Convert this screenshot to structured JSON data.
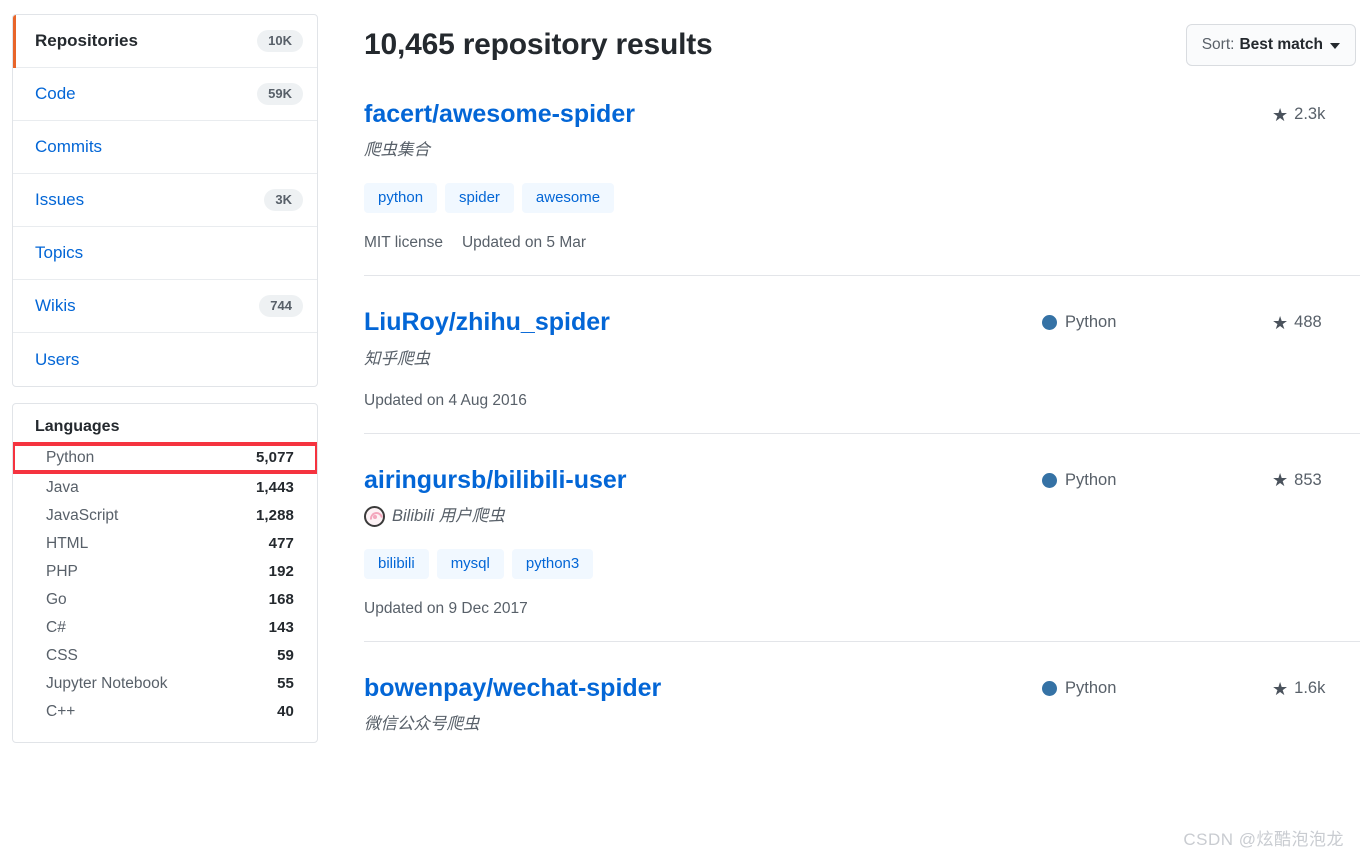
{
  "sidebar": {
    "nav_items": [
      {
        "label": "Repositories",
        "count": "10K",
        "active": true
      },
      {
        "label": "Code",
        "count": "59K",
        "active": false
      },
      {
        "label": "Commits",
        "count": "",
        "active": false
      },
      {
        "label": "Issues",
        "count": "3K",
        "active": false
      },
      {
        "label": "Topics",
        "count": "",
        "active": false
      },
      {
        "label": "Wikis",
        "count": "744",
        "active": false
      },
      {
        "label": "Users",
        "count": "",
        "active": false
      }
    ],
    "languages": {
      "title": "Languages",
      "items": [
        {
          "label": "Python",
          "count": "5,077",
          "highlighted": true
        },
        {
          "label": "Java",
          "count": "1,443",
          "highlighted": false
        },
        {
          "label": "JavaScript",
          "count": "1,288",
          "highlighted": false
        },
        {
          "label": "HTML",
          "count": "477",
          "highlighted": false
        },
        {
          "label": "PHP",
          "count": "192",
          "highlighted": false
        },
        {
          "label": "Go",
          "count": "168",
          "highlighted": false
        },
        {
          "label": "C#",
          "count": "143",
          "highlighted": false
        },
        {
          "label": "CSS",
          "count": "59",
          "highlighted": false
        },
        {
          "label": "Jupyter Notebook",
          "count": "55",
          "highlighted": false
        },
        {
          "label": "C++",
          "count": "40",
          "highlighted": false
        }
      ]
    }
  },
  "main": {
    "results_title": "10,465 repository results",
    "sort": {
      "label": "Sort:",
      "value": "Best match"
    },
    "results": [
      {
        "name": "facert/awesome-spider",
        "description": "爬虫集合",
        "emoji": "",
        "language": "",
        "language_color": "",
        "stars": "2.3k",
        "topics": [
          "python",
          "spider",
          "awesome"
        ],
        "license": "MIT license",
        "updated": "Updated on 5 Mar"
      },
      {
        "name": "LiuRoy/zhihu_spider",
        "description": "知乎爬虫",
        "emoji": "",
        "language": "Python",
        "language_color": "#3572A5",
        "stars": "488",
        "topics": [],
        "license": "",
        "updated": "Updated on 4 Aug 2016"
      },
      {
        "name": "airingursb/bilibili-user",
        "description": "Bilibili 用户爬虫",
        "emoji": "narutomaki-icon",
        "language": "Python",
        "language_color": "#3572A5",
        "stars": "853",
        "topics": [
          "bilibili",
          "mysql",
          "python3"
        ],
        "license": "",
        "updated": "Updated on 9 Dec 2017"
      },
      {
        "name": "bowenpay/wechat-spider",
        "description": "微信公众号爬虫",
        "emoji": "",
        "language": "Python",
        "language_color": "#3572A5",
        "stars": "1.6k",
        "topics": [],
        "license": "",
        "updated": ""
      }
    ]
  },
  "watermark": "CSDN @炫酷泡泡龙",
  "colors": {
    "accent_orange": "#e8652a",
    "link_blue": "#0366d6",
    "highlight_red": "#f5333f",
    "python_dot": "#3572A5",
    "star_gray": "#4a525c"
  }
}
